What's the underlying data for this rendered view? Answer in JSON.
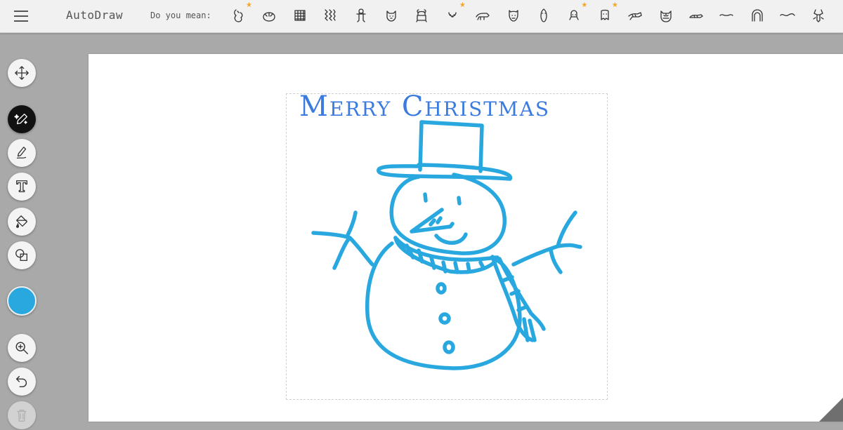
{
  "app": {
    "title": "AutoDraw"
  },
  "suggestions": {
    "label": "Do you mean:",
    "items": [
      {
        "name": "bear-sketch-icon",
        "starred": true
      },
      {
        "name": "bush-icon",
        "starred": false
      },
      {
        "name": "waffle-icon",
        "starred": false
      },
      {
        "name": "fur-texture-icon",
        "starred": false
      },
      {
        "name": "gingerbread-icon",
        "starred": false
      },
      {
        "name": "dog-face-icon",
        "starred": false
      },
      {
        "name": "teddy-bear-icon",
        "starred": false
      },
      {
        "name": "polar-bear-face-icon",
        "starred": true
      },
      {
        "name": "polar-bear-icon",
        "starred": false
      },
      {
        "name": "bear-face-icon",
        "starred": false
      },
      {
        "name": "penguin-icon",
        "starred": false
      },
      {
        "name": "small-bear-icon",
        "starred": true
      },
      {
        "name": "ghost-bear-icon",
        "starred": true
      },
      {
        "name": "tiger-icon",
        "starred": false
      },
      {
        "name": "tiger-face-icon",
        "starred": false
      },
      {
        "name": "lying-animal-icon",
        "starred": false
      },
      {
        "name": "mustache-icon",
        "starred": false
      },
      {
        "name": "hair-arch-icon",
        "starred": false
      },
      {
        "name": "wave-line-icon",
        "starred": false
      },
      {
        "name": "lobster-icon",
        "starred": false
      }
    ]
  },
  "toolbar": {
    "tools": [
      "move-icon",
      "autodraw-icon",
      "pencil-icon",
      "text-icon",
      "fill-icon",
      "shape-icon",
      "color-swatch",
      "zoom-icon",
      "undo-icon",
      "delete-icon"
    ],
    "active_tool": "autodraw-icon",
    "current_color": "#29a8e0"
  },
  "canvas": {
    "text": "Merry Christmas",
    "text_color": "#3b7be0",
    "drawing_color": "#29a8e0"
  }
}
